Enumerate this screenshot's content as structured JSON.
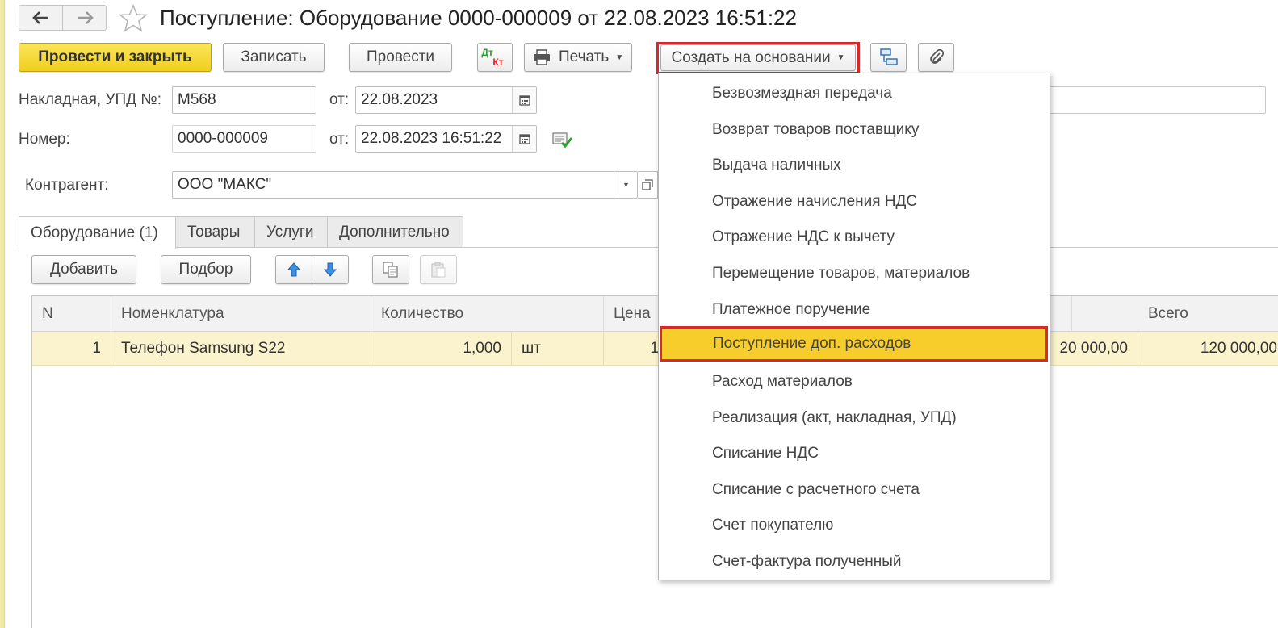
{
  "window": {
    "title": "Поступление: Оборудование 0000-000009 от 22.08.2023 16:51:22"
  },
  "toolbar": {
    "post_close": "Провести и закрыть",
    "save": "Записать",
    "post": "Провести",
    "dt": "Дт",
    "kt": "Кт",
    "print": "Печать",
    "create_based": "Создать на основании"
  },
  "form": {
    "invoice_label": "Накладная, УПД №:",
    "invoice_value": "М568",
    "from_label": "от:",
    "invoice_date": "22.08.2023",
    "number_label": "Номер:",
    "number_value": "0000-000009",
    "number_date": "22.08.2023 16:51:22",
    "contractor_label": "Контрагент:",
    "contractor_value": "ООО \"МАКС\""
  },
  "tabs": [
    {
      "label": "Оборудование (1)",
      "active": true
    },
    {
      "label": "Товары"
    },
    {
      "label": "Услуги"
    },
    {
      "label": "Дополнительно"
    }
  ],
  "table_toolbar": {
    "add": "Добавить",
    "pick": "Подбор"
  },
  "table": {
    "headers": {
      "n": "N",
      "nomenclature": "Номенклатура",
      "quantity": "Количество",
      "price": "Цена",
      "total": "Всего"
    },
    "rows": [
      {
        "n": "1",
        "nomenclature": "Телефон Samsung S22",
        "quantity": "1,000",
        "unit": "шт",
        "price_partial": "1",
        "vat": "20 000,00",
        "total": "120 000,00"
      }
    ]
  },
  "menu": {
    "items": [
      "Безвозмездная передача",
      "Возврат товаров поставщику",
      "Выдача наличных",
      "Отражение начисления НДС",
      "Отражение НДС к вычету",
      "Перемещение товаров, материалов",
      "Платежное поручение",
      "Поступление доп. расходов",
      "Расход материалов",
      "Реализация (акт, накладная, УПД)",
      "Списание НДС",
      "Списание с расчетного счета",
      "Счет покупателю",
      "Счет-фактура полученный"
    ],
    "selected_index": 7
  },
  "colors": {
    "primary_button": "#f0cf1c",
    "highlight_red": "#d9272e",
    "selected_row": "#fbf3cd",
    "menu_selected": "#f7cd2b"
  }
}
